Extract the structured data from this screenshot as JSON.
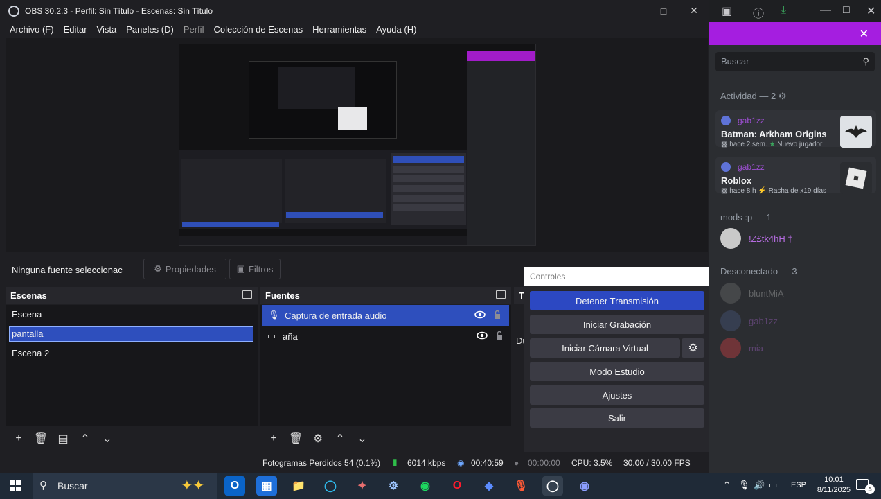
{
  "obs": {
    "title": "OBS 30.2.3 - Perfil: Sin Título - Escenas: Sin Título",
    "menu": [
      "Archivo (F)",
      "Editar",
      "Vista",
      "Paneles (D)",
      "Perfil",
      "Colección de Escenas",
      "Herramientas",
      "Ayuda (H)"
    ],
    "no_source": "Ninguna fuente seleccionac",
    "properties_label": "Propiedades",
    "filters_label": "Filtros",
    "scenes": {
      "title": "Escenas",
      "items": [
        "Escena",
        "pantalla",
        "Escena 2"
      ],
      "selected_index": 1
    },
    "sources": {
      "title": "Fuentes",
      "items": [
        {
          "label": "Captura de entrada audio",
          "icon": "microphone-icon",
          "selected": true
        },
        {
          "label": "aña",
          "icon": "monitor-icon",
          "selected": false
        }
      ]
    },
    "transitions_partial": {
      "header": "Tr",
      "label": "Du"
    },
    "controls": {
      "title": "Controles",
      "buttons": [
        "Detener Transmisión",
        "Iniciar Grabación",
        "Iniciar Cámara Virtual",
        "Modo Estudio",
        "Ajustes",
        "Salir"
      ]
    },
    "status": {
      "dropped": "Fotogramas Perdidos 54 (0.1%)",
      "bitrate": "6014 kbps",
      "stream_time": "00:40:59",
      "rec_time": "00:00:00",
      "cpu": "CPU: 3.5%",
      "fps": "30.00 / 30.00 FPS"
    },
    "accent_color": "#2e4fbd"
  },
  "discord": {
    "search_placeholder": "Buscar",
    "activity_header": "Actividad — 2",
    "activities": [
      {
        "user": "gab1zz",
        "game": "Batman: Arkham Origins",
        "time": "hace 2 sem.",
        "extra": "Nuevo jugador"
      },
      {
        "user": "gab1zz",
        "game": "Roblox",
        "time": "hace 8 h",
        "extra": "Racha de x19 días"
      }
    ],
    "mods_header": "mods :p — 1",
    "mods": [
      {
        "name": "!Z£tk4hH †"
      }
    ],
    "offline_header": "Desconectado — 3",
    "offline": [
      {
        "name": "bluntMiA"
      },
      {
        "name": "gab1zz"
      },
      {
        "name": "mia"
      }
    ],
    "brand_color": "#a51ee0"
  },
  "taskbar": {
    "search_label": "Buscar",
    "language": "ESP",
    "time": "10:01",
    "date": "8/11/2025",
    "notifications": "5"
  }
}
